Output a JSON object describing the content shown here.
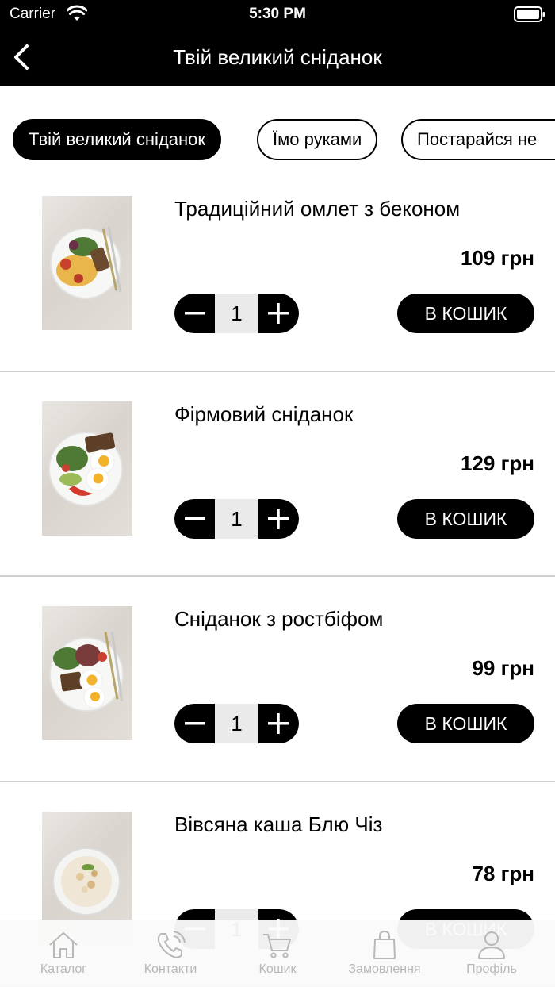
{
  "status_bar": {
    "carrier": "Carrier",
    "time": "5:30 PM"
  },
  "nav": {
    "title": "Твій великий сніданок",
    "back_icon": "chevron-left-icon"
  },
  "chips": [
    {
      "label": "Твій великий сніданок",
      "active": true
    },
    {
      "label": "Їмо руками",
      "active": false
    },
    {
      "label": "Постарайся не",
      "active": false
    }
  ],
  "products": [
    {
      "name": "Традиційний омлет з беконом",
      "price": "109 грн",
      "qty": "1",
      "add_label": "В КОШИК"
    },
    {
      "name": "Фірмовий сніданок",
      "price": "129 грн",
      "qty": "1",
      "add_label": "В КОШИК"
    },
    {
      "name": "Сніданок з ростбіфом",
      "price": "99 грн",
      "qty": "1",
      "add_label": "В КОШИК"
    },
    {
      "name": "Вівсяна каша Блю Чіз",
      "price": "78 грн",
      "qty": "1",
      "add_label": "В КОШИК"
    }
  ],
  "tab_bar": [
    {
      "label": "Каталог",
      "icon": "home-icon"
    },
    {
      "label": "Контакти",
      "icon": "phone-icon"
    },
    {
      "label": "Кошик",
      "icon": "cart-icon"
    },
    {
      "label": "Замовлення",
      "icon": "shopping-bag-icon"
    },
    {
      "label": "Профіль",
      "icon": "user-icon"
    }
  ],
  "colors": {
    "bar_bg": "#000000",
    "tab_inactive": "#b8b8b8",
    "divider": "#cfcfcf"
  }
}
